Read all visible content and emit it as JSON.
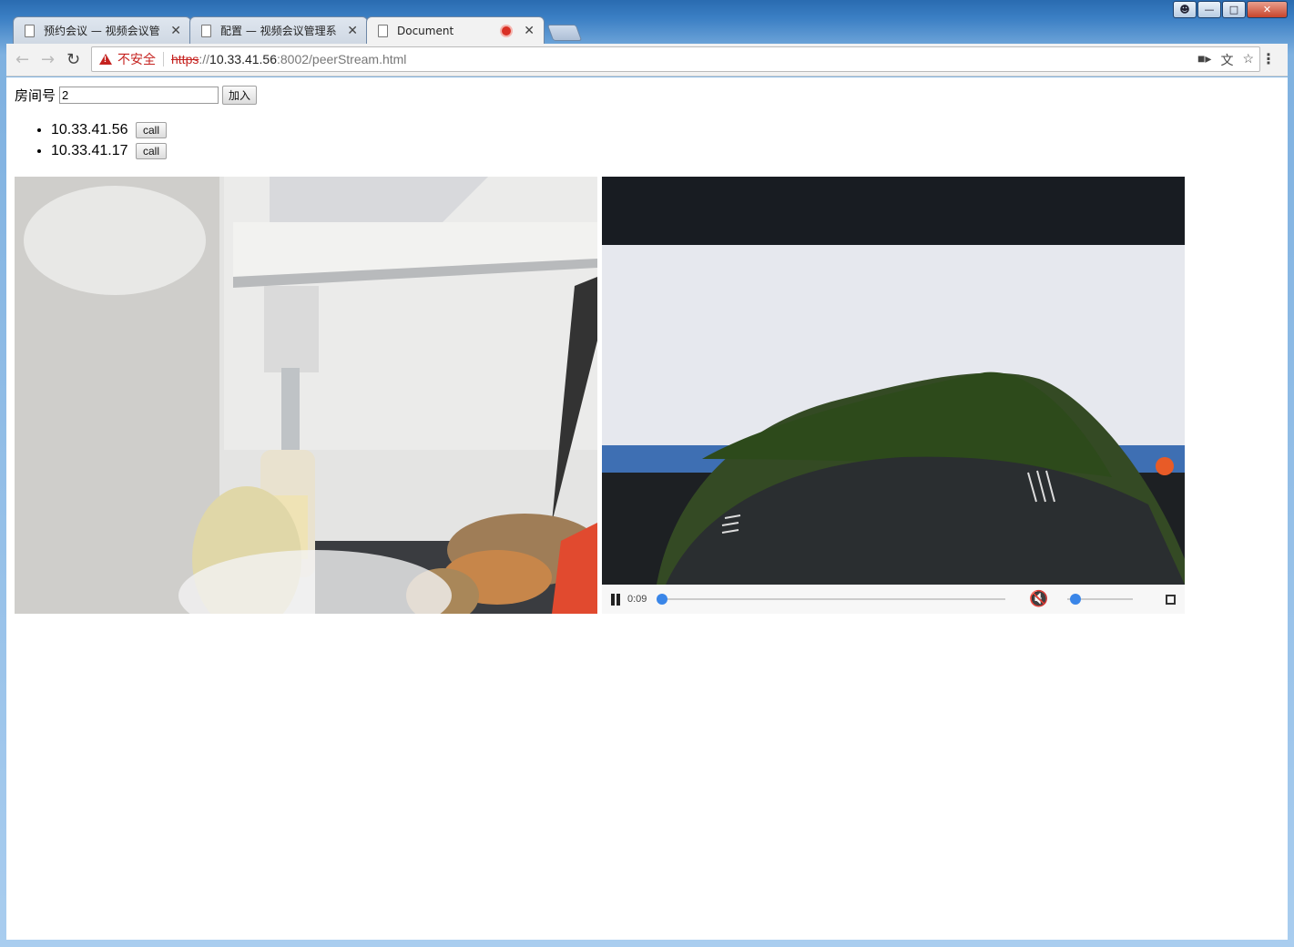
{
  "browser": {
    "tabs": [
      {
        "title": "预约会议 — 视频会议管"
      },
      {
        "title": "配置 — 视频会议管理系"
      },
      {
        "title": "Document"
      }
    ],
    "url": {
      "security_label": "不安全",
      "protocol": "https",
      "separator": "://",
      "host": "10.33.41.56",
      "path": ":8002/peerStream.html"
    },
    "omnibox_icons": [
      "camera-icon",
      "translate-icon",
      "star-icon"
    ]
  },
  "page": {
    "room_label": "房间号",
    "room_value": "2",
    "join_label": "加入",
    "peers": [
      {
        "ip": "10.33.41.56",
        "call_label": "call"
      },
      {
        "ip": "10.33.41.17",
        "call_label": "call"
      }
    ],
    "remote_video": {
      "time": "0:09",
      "progress_fraction": 0.0,
      "muted": true,
      "volume_fraction": 0.05
    }
  },
  "colors": {
    "accent": "#3a86e8",
    "insecure": "#c5221f",
    "recording": "#d93025"
  }
}
